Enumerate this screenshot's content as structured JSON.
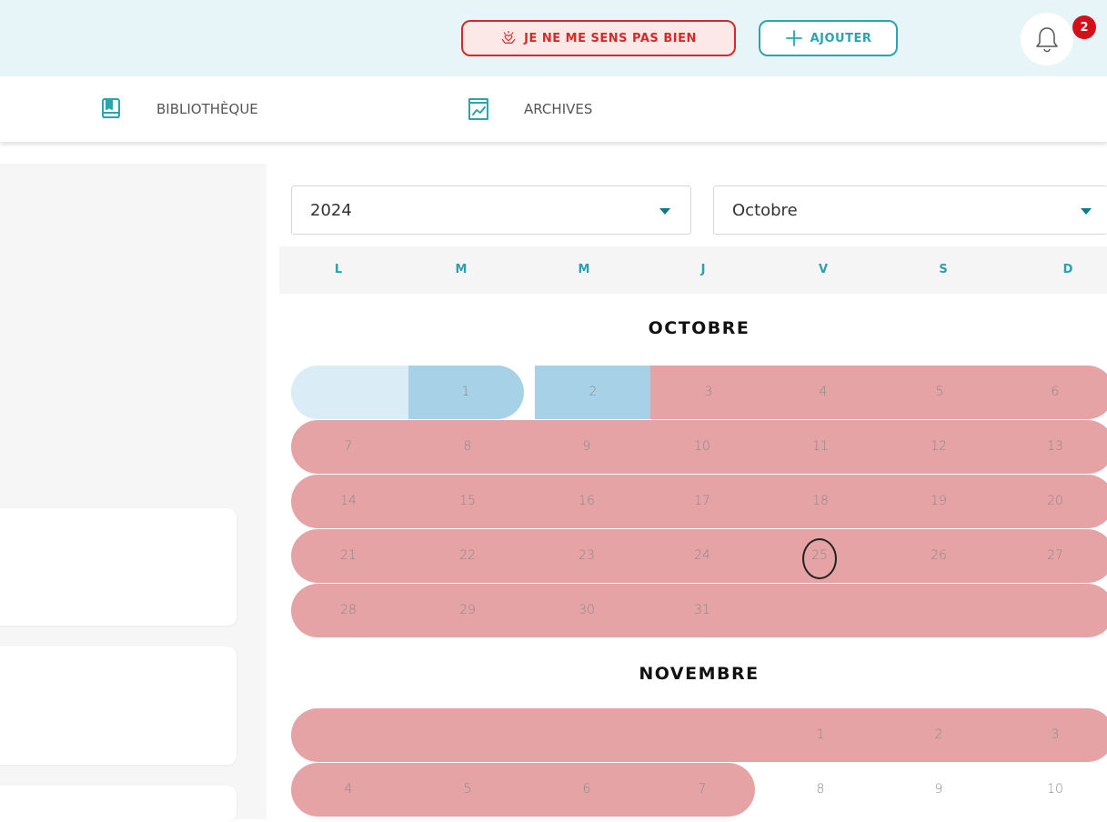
{
  "header": {
    "sick_button_label": "JE NE ME SENS PAS BIEN",
    "add_button_label": "AJOUTER",
    "notification_count": "2"
  },
  "nav": {
    "items": [
      {
        "label": "BIBLIOTHÈQUE",
        "icon": "book-icon"
      },
      {
        "label": "ARCHIVES",
        "icon": "archive-chart-icon"
      }
    ]
  },
  "filters": {
    "year": "2024",
    "month": "Octobre"
  },
  "calendar": {
    "weekdays": [
      "L",
      "M",
      "M",
      "J",
      "V",
      "S",
      "D"
    ],
    "months": [
      {
        "title": "OCTOBRE",
        "days": [
          "1",
          "2",
          "3",
          "4",
          "5",
          "6",
          "7",
          "8",
          "9",
          "10",
          "11",
          "12",
          "13",
          "14",
          "15",
          "16",
          "17",
          "18",
          "19",
          "20",
          "21",
          "22",
          "23",
          "24",
          "25",
          "26",
          "27",
          "28",
          "29",
          "30",
          "31"
        ]
      },
      {
        "title": "NOVEMBRE",
        "days": [
          "1",
          "2",
          "3",
          "4",
          "5",
          "6",
          "7",
          "8",
          "9",
          "10"
        ]
      }
    ],
    "today": "25"
  },
  "colors": {
    "topbar_bg": "#e8f5f8",
    "sick_red": "#d42a2a",
    "teal": "#2aa5b0",
    "badge_red": "#d40f1a",
    "symptom_band": "#e5a3a5",
    "blue_band": "#a6d1e6",
    "light_blue_band": "#daecf5"
  }
}
